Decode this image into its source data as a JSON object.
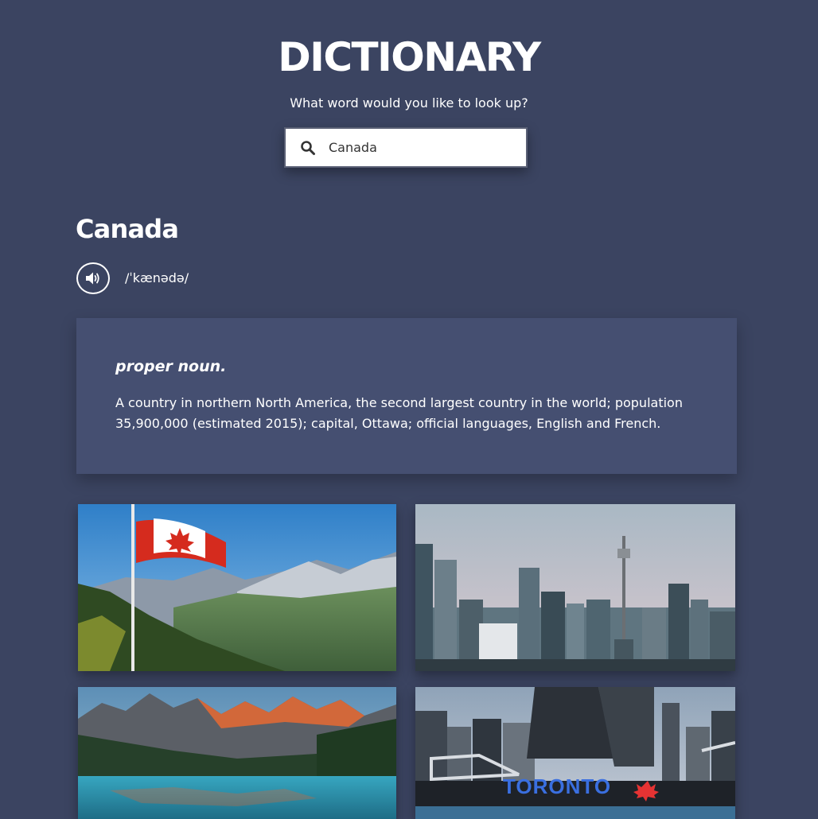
{
  "header": {
    "title": "DICTIONARY",
    "prompt": "What word would you like to look up?"
  },
  "search": {
    "value": "Canada",
    "icon": "search-icon"
  },
  "result": {
    "word": "Canada",
    "phonetic": "/ˈkænədə/",
    "audio_icon": "speaker-icon",
    "meanings": [
      {
        "part_of_speech": "proper noun.",
        "definition": "A country in northern North America, the second largest country in the world; population 35,900,000 (estimated 2015); capital, Ottawa; official languages, English and French."
      }
    ]
  },
  "photos": {
    "toronto_sign_text": "TORONTO"
  },
  "colors": {
    "background": "#3b4461",
    "card": "#454f71",
    "text": "#ffffff"
  }
}
